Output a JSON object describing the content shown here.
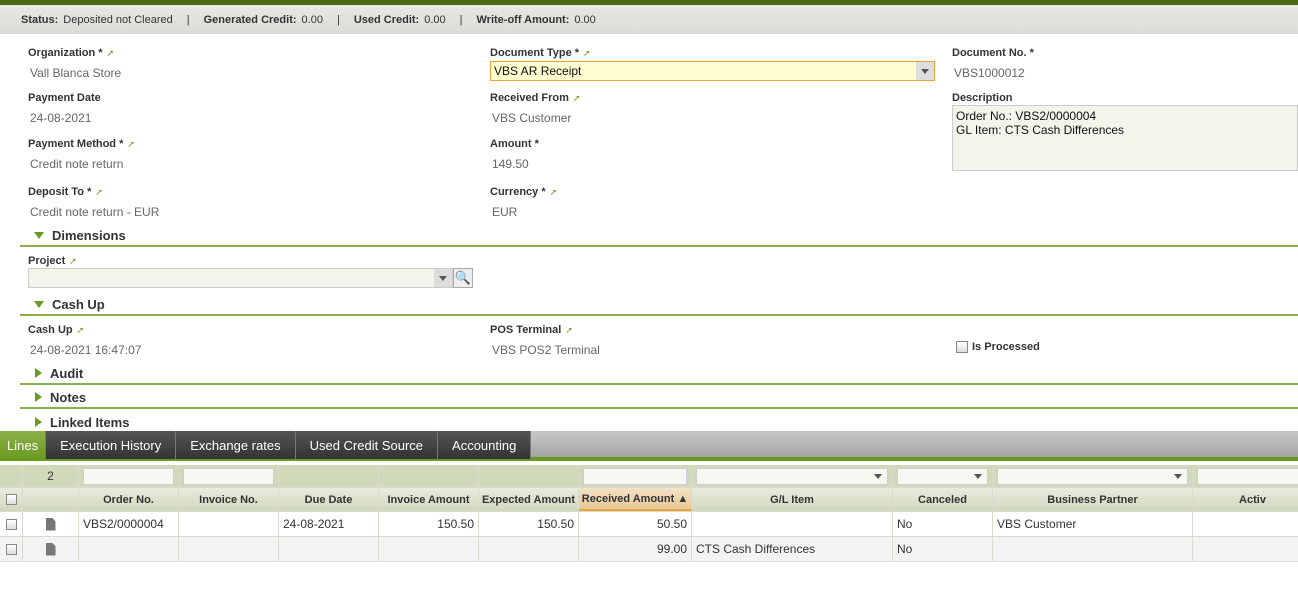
{
  "status": {
    "status_label": "Status:",
    "status_value": "Deposited not Cleared",
    "generated_label": "Generated Credit:",
    "generated_value": "0.00",
    "used_label": "Used Credit:",
    "used_value": "0.00",
    "writeoff_label": "Write-off Amount:",
    "writeoff_value": "0.00",
    "separator": "|"
  },
  "form": {
    "organization": {
      "label": "Organization *",
      "value": "Vall Blanca Store"
    },
    "document_type": {
      "label": "Document Type *",
      "value": "VBS AR Receipt"
    },
    "document_no": {
      "label": "Document No. *",
      "value": "VBS1000012"
    },
    "payment_date": {
      "label": "Payment Date",
      "value": "24-08-2021"
    },
    "received_from": {
      "label": "Received From",
      "value": "VBS Customer"
    },
    "description": {
      "label": "Description",
      "value": "Order No.: VBS2/0000004\nGL Item: CTS Cash Differences"
    },
    "payment_method": {
      "label": "Payment Method *",
      "value": "Credit note return"
    },
    "amount": {
      "label": "Amount *",
      "value": "149.50"
    },
    "deposit_to": {
      "label": "Deposit To *",
      "value": "Credit note return - EUR"
    },
    "currency": {
      "label": "Currency *",
      "value": "EUR"
    },
    "project": {
      "label": "Project",
      "value": ""
    },
    "cash_up": {
      "label": "Cash Up",
      "value": "24-08-2021 16:47:07"
    },
    "pos_terminal": {
      "label": "POS Terminal",
      "value": "VBS POS2 Terminal"
    },
    "is_processed": {
      "label": "Is Processed",
      "checked": false
    }
  },
  "sections": {
    "dimensions": "Dimensions",
    "cash_up": "Cash Up",
    "audit": "Audit",
    "notes": "Notes",
    "linked_items": "Linked Items"
  },
  "tabs": [
    "Lines",
    "Execution History",
    "Exchange rates",
    "Used Credit Source",
    "Accounting"
  ],
  "grid": {
    "row_count": "2",
    "columns": [
      "Order No.",
      "Invoice No.",
      "Due Date",
      "Invoice Amount",
      "Expected Amount",
      "Received Amount ▲",
      "G/L Item",
      "Canceled",
      "Business Partner",
      "Activ"
    ],
    "rows": [
      [
        "VBS2/0000004",
        "",
        "24-08-2021",
        "150.50",
        "150.50",
        "50.50",
        "",
        "No",
        "VBS Customer",
        ""
      ],
      [
        "",
        "",
        "",
        "",
        "",
        "99.00",
        "CTS Cash Differences",
        "No",
        "",
        ""
      ]
    ]
  },
  "colors": {
    "accent": "#6a9a1f",
    "topbar": "#4a6b14"
  }
}
